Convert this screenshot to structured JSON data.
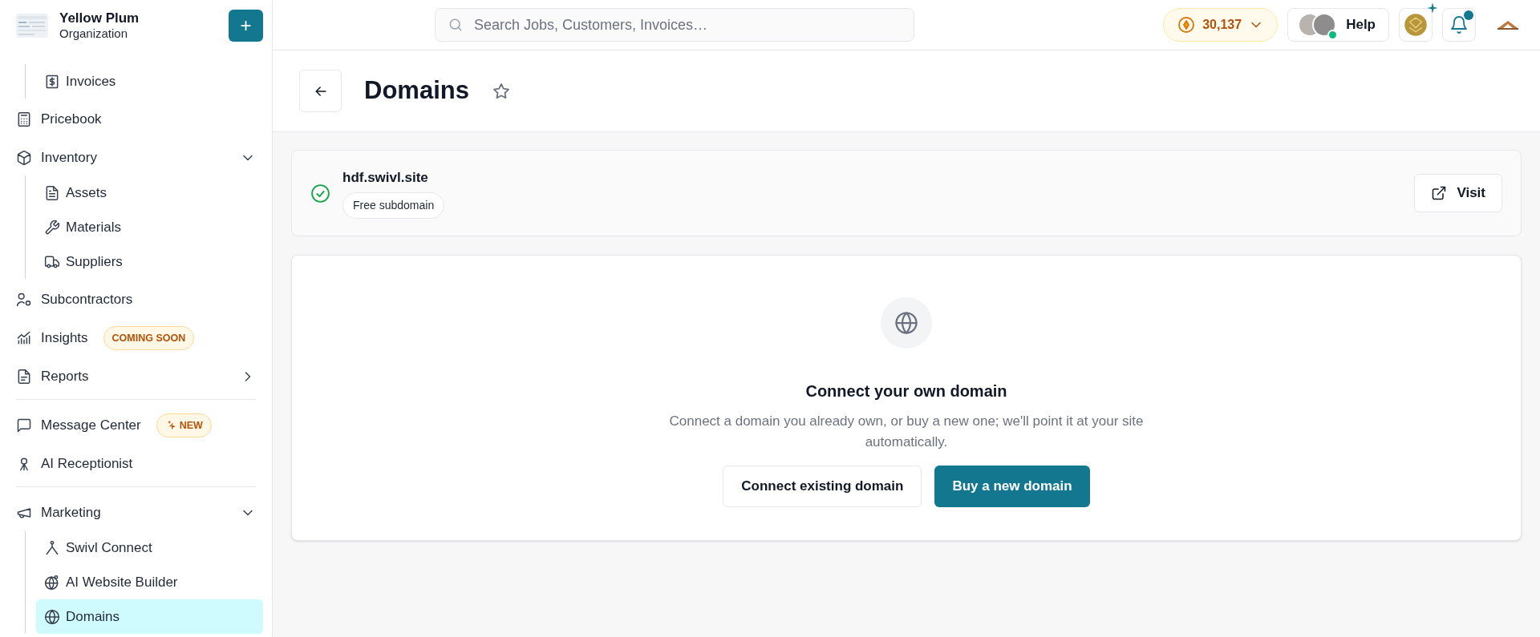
{
  "organization": {
    "name": "Yellow Plum",
    "subtitle": "Organization",
    "add_label": "+"
  },
  "sidebar": {
    "sections": [
      {
        "items": [
          {
            "kind": "continuation",
            "children": [
              {
                "label": "Invoices",
                "selected": false
              }
            ]
          },
          {
            "kind": "item",
            "label": "Pricebook",
            "selected": false
          },
          {
            "kind": "group",
            "label": "Inventory",
            "expanded": true,
            "children": [
              {
                "label": "Assets",
                "selected": false
              },
              {
                "label": "Materials",
                "selected": false
              },
              {
                "label": "Suppliers",
                "selected": false
              }
            ]
          },
          {
            "kind": "item",
            "label": "Subcontractors",
            "selected": false
          },
          {
            "kind": "item",
            "label": "Insights",
            "selected": false,
            "badge": {
              "kind": "plain",
              "text": "COMING SOON"
            }
          },
          {
            "kind": "group",
            "label": "Reports",
            "expanded": false
          }
        ]
      },
      {
        "items": [
          {
            "kind": "item",
            "label": "Message Center",
            "selected": false,
            "badge": {
              "kind": "sparkle",
              "text": "NEW"
            }
          },
          {
            "kind": "item",
            "label": "AI Receptionist",
            "selected": false
          }
        ]
      },
      {
        "items": [
          {
            "kind": "group",
            "label": "Marketing",
            "expanded": true,
            "children": [
              {
                "label": "Swivl Connect",
                "selected": false
              },
              {
                "label": "AI Website Builder",
                "selected": false
              },
              {
                "label": "Domains",
                "selected": true
              }
            ]
          }
        ]
      }
    ]
  },
  "search": {
    "placeholder": "Search Jobs, Customers, Invoices…"
  },
  "topbar": {
    "coins": "30,137",
    "help": "Help",
    "online": true,
    "unread_notifications": true
  },
  "page": {
    "title": "Domains",
    "favorite": false
  },
  "domain": {
    "name": "hdf.swivl.site",
    "verified": true,
    "tag": "Free subdomain",
    "action": "Visit"
  },
  "empty_state": {
    "title": "Connect your own domain",
    "description": "Connect a domain you already own, or buy a new one; we'll point it at your site automatically.",
    "buttons": [
      {
        "label": "Connect existing domain",
        "primary": false
      },
      {
        "label": "Buy a new domain",
        "primary": true
      }
    ]
  }
}
